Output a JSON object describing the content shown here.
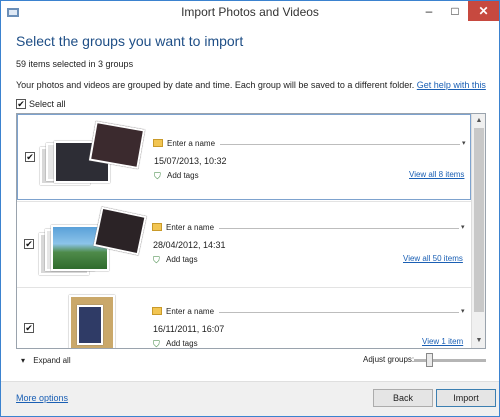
{
  "window": {
    "title": "Import Photos and Videos",
    "minimize": "–",
    "maximize": "□",
    "close": "✕"
  },
  "header": {
    "heading": "Select the groups you want to import",
    "count": "59 items selected in 3 groups",
    "description": "Your photos and videos are grouped by date and time. Each group will be saved to a different folder.",
    "help_link": "Get help with this"
  },
  "select_all": {
    "label": "Select all",
    "checked": true
  },
  "groups": [
    {
      "name_placeholder": "Enter a name",
      "date": "15/07/2013, 10:32",
      "tags_label": "Add tags",
      "view_link": "View all 8 items",
      "checked": true
    },
    {
      "name_placeholder": "Enter a name",
      "date": "28/04/2012, 14:31",
      "tags_label": "Add tags",
      "view_link": "View all 50 items",
      "checked": true
    },
    {
      "name_placeholder": "Enter a name",
      "date": "16/11/2011, 16:07",
      "tags_label": "Add tags",
      "view_link": "View 1 item",
      "checked": true
    }
  ],
  "controls": {
    "expand_all": "Expand all",
    "adjust_groups": "Adjust groups:"
  },
  "footer": {
    "more_options": "More options",
    "back": "Back",
    "import": "Import"
  },
  "icons": {
    "check": "✔",
    "chevron": "▾",
    "tag": "⛉"
  },
  "colors": {
    "heading": "#1e4e86",
    "link": "#1a5fb4",
    "close": "#c7493f"
  }
}
